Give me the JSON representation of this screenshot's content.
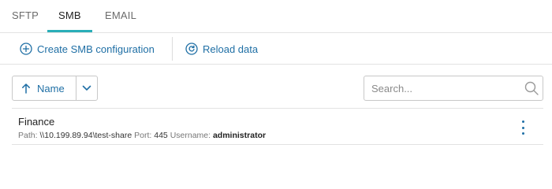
{
  "tabs": [
    {
      "label": "SFTP",
      "active": false
    },
    {
      "label": "SMB",
      "active": true
    },
    {
      "label": "EMAIL",
      "active": false
    }
  ],
  "actions": {
    "create_label": "Create SMB configuration",
    "reload_label": "Reload data"
  },
  "sort": {
    "label": "Name",
    "direction": "ascending"
  },
  "search": {
    "placeholder": "Search...",
    "value": ""
  },
  "configurations": [
    {
      "name": "Finance",
      "path_label": "Path:",
      "path": "\\\\10.199.89.94\\test-share",
      "port_label": "Port:",
      "port": "445",
      "username_label": "Username:",
      "username": "administrator"
    }
  ],
  "colors": {
    "accent": "#2aaeb8",
    "link": "#1f6fa5",
    "border": "#e2e2e2"
  }
}
